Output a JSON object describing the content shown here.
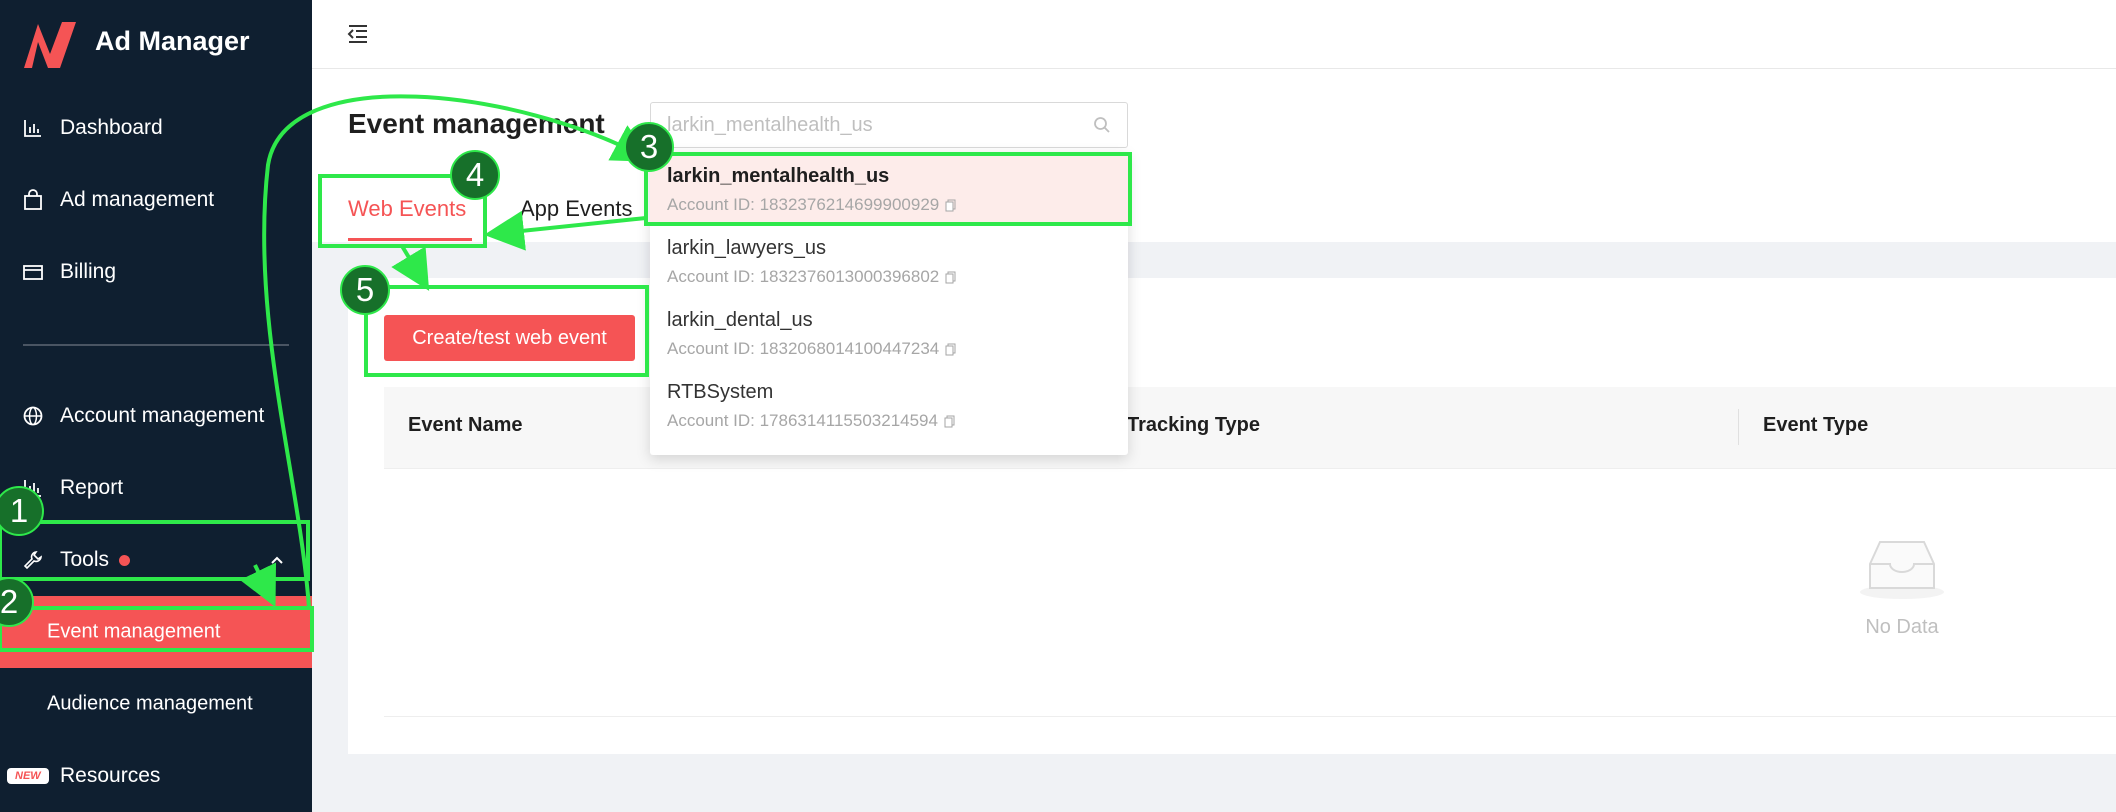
{
  "app": {
    "title": "Ad Manager"
  },
  "sidebar": {
    "items": [
      {
        "label": "Dashboard",
        "icon": "bar-chart-icon"
      },
      {
        "label": "Ad management",
        "icon": "bag-icon"
      },
      {
        "label": "Billing",
        "icon": "card-icon"
      },
      {
        "label": "Account management",
        "icon": "globe-icon"
      },
      {
        "label": "Report",
        "icon": "report-icon"
      },
      {
        "label": "Tools",
        "icon": "wrench-icon"
      }
    ],
    "subitems": [
      {
        "label": "Event management",
        "active": true
      },
      {
        "label": "Audience management"
      }
    ],
    "resources": {
      "label": "Resources",
      "badge": "NEW"
    }
  },
  "page": {
    "title": "Event management",
    "search_value": "larkin_mentalhealth_us",
    "tabs": [
      {
        "label": "Web Events"
      },
      {
        "label": "App Events"
      }
    ],
    "create_button": "Create/test web event",
    "table": {
      "columns": [
        "Event Name",
        "Tracking Type",
        "Event Type"
      ],
      "empty_text": "No Data"
    }
  },
  "dropdown": {
    "options": [
      {
        "name": "larkin_mentalhealth_us",
        "account": "Account ID: 1832376214699900929",
        "selected": true
      },
      {
        "name": "larkin_lawyers_us",
        "account": "Account ID: 1832376013000396802"
      },
      {
        "name": "larkin_dental_us",
        "account": "Account ID: 1832068014100447234"
      },
      {
        "name": "RTBSystem",
        "account": "Account ID: 1786314115503214594"
      }
    ]
  },
  "annotations": {
    "steps": [
      "1",
      "2",
      "3",
      "4",
      "5"
    ]
  },
  "colors": {
    "sidebar_bg": "#0f1f30",
    "accent": "#f55455",
    "annotation": "#2ee84a",
    "badge_bg": "#17702a"
  }
}
